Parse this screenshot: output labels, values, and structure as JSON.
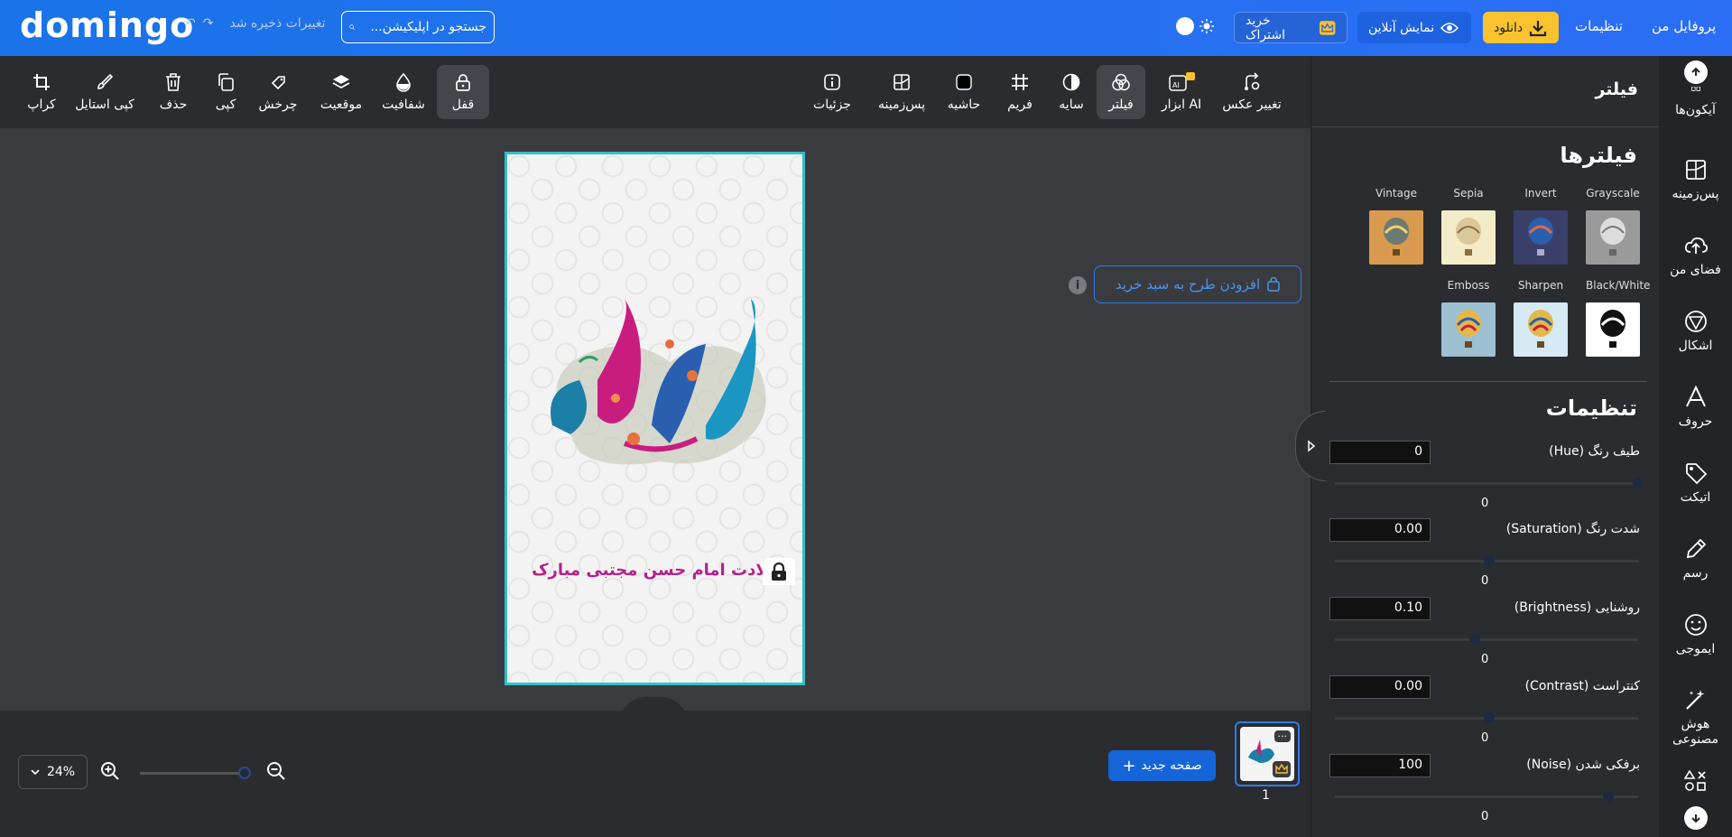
{
  "header": {
    "logo": "domingo",
    "save_status": "تغییرات ذخیره شد",
    "search_placeholder": "جستجو در اپلیکیشن...",
    "subscribe_label": "خرید اشتراک",
    "preview_label": "نمایش آنلاین",
    "download_label": "دانلود",
    "settings_label": "تنظیمات",
    "profile_label": "پروفایل من"
  },
  "toolbar": {
    "crop": "کراپ",
    "copy_style": "کپی استایل",
    "delete": "حذف",
    "copy": "کپی",
    "rotate": "چرخش",
    "position": "موقعیت",
    "opacity": "شفافیت",
    "lock": "قفل",
    "details": "جزئیات",
    "background": "پس‌زمینه",
    "border": "حاشیه",
    "frame": "فریم",
    "shadow": "سایه",
    "filter": "فیلتر",
    "ai_tools": "ابزار AI",
    "change_photo": "تغییر عکس"
  },
  "canvas": {
    "add_to_cart": "افزودن طرح به سبد خرید",
    "info": "i",
    "greeting": "ولادت امام حسن مجتبی مبارک"
  },
  "bottom": {
    "zoom": "24%",
    "new_page": "صفحه جدید",
    "page_number": "1",
    "thumb_menu": "···"
  },
  "panel": {
    "title": "فیلتر",
    "filters_title": "فیلترها",
    "filters": [
      {
        "name": "Grayscale",
        "color": "#9a9a9a"
      },
      {
        "name": "Invert",
        "color": "#3a3f6a"
      },
      {
        "name": "Sepia",
        "color": "#f3ecc8"
      },
      {
        "name": "Vintage",
        "color": "#d99a4f"
      },
      {
        "name": "Black/White",
        "color": "#ffffff"
      },
      {
        "name": "Sharpen",
        "color": "#d5eaf2"
      },
      {
        "name": "Emboss",
        "color": "#9ec0d3"
      }
    ],
    "settings_title": "تنظیمات",
    "settings": [
      {
        "name": "طیف رنگ (Hue)",
        "value": "0",
        "zero": "0",
        "level": 1.0
      },
      {
        "name": "شدت رنگ (Saturation)",
        "value": "0.00",
        "zero": "0",
        "level": 0.5
      },
      {
        "name": "روشنایی (Brightness)",
        "value": "0.10",
        "zero": "0",
        "level": 0.45
      },
      {
        "name": "کنتراست (Contrast)",
        "value": "0.00",
        "zero": "0",
        "level": 0.5
      },
      {
        "name": "برفکی شدن (Noise)",
        "value": "100",
        "zero": "0",
        "level": 0.9
      }
    ]
  },
  "sidenav": {
    "icons": "آیکون‌ها",
    "background": "پس‌زمینه",
    "my_space": "فضای من",
    "shapes": "اشکال",
    "letters": "حروف",
    "sticker": "اتیکت",
    "draw": "رسم",
    "emoji": "ایموجی",
    "ai": "هوش مصنوعی"
  },
  "colors": {
    "header_blue": "#1a73e8",
    "accent_yellow": "#f9c22e",
    "canvas_border": "#2fc0c9",
    "primary_button": "#1565d8"
  }
}
